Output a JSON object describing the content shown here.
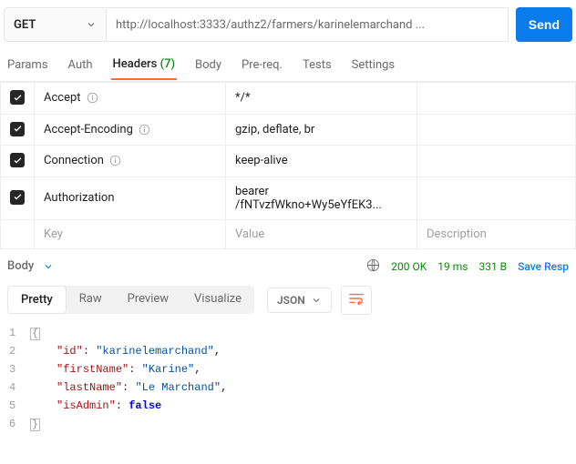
{
  "request": {
    "method": "GET",
    "url": "http://localhost:3333/authz2/farmers/karinelemarchand ...",
    "send_label": "Send"
  },
  "tabs": {
    "params": "Params",
    "auth": "Auth",
    "headers_label": "Headers",
    "headers_count": "(7)",
    "body": "Body",
    "prereq": "Pre-req.",
    "tests": "Tests",
    "settings": "Settings"
  },
  "headers": [
    {
      "enabled": true,
      "key": "Accept",
      "info": true,
      "value": "*/*"
    },
    {
      "enabled": true,
      "key": "Accept-Encoding",
      "info": true,
      "value": "gzip, deflate, br"
    },
    {
      "enabled": true,
      "key": "Connection",
      "info": true,
      "value": "keep-alive"
    },
    {
      "enabled": true,
      "key": "Authorization",
      "info": false,
      "value": "bearer /fNTvzfWkno+Wy5eYfEK3..."
    }
  ],
  "headers_placeholder": {
    "key": "Key",
    "value": "Value",
    "description": "Description"
  },
  "response_bar": {
    "body_label": "Body",
    "status_code": "200 OK",
    "time": "19 ms",
    "size": "331 B",
    "save_label": "Save Resp"
  },
  "response_toolbar": {
    "pretty": "Pretty",
    "raw": "Raw",
    "preview": "Preview",
    "visualize": "Visualize",
    "format": "JSON"
  },
  "json_body": {
    "lines": [
      "1",
      "2",
      "3",
      "4",
      "5",
      "6"
    ],
    "l2_k": "\"id\"",
    "l2_v": "\"karinelemarchand\"",
    "l3_k": "\"firstName\"",
    "l3_v": "\"Karine\"",
    "l4_k": "\"lastName\"",
    "l4_v": "\"Le Marchand\"",
    "l5_k": "\"isAdmin\"",
    "l5_v": "false"
  }
}
